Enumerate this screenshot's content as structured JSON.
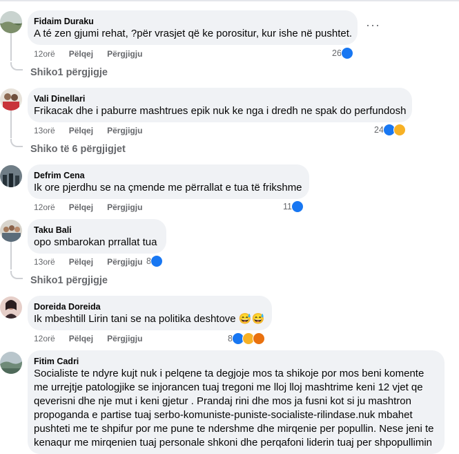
{
  "comments": [
    {
      "author": "Fidaim Duraku",
      "text": "A té zen gjumi rehat, ?për vrasjet që ke porositur, kur ishe në pushtet.",
      "time": "12orë",
      "like_label": "Pëlqej",
      "reply_label": "Përgjigju",
      "reaction_count": "26",
      "reactions": [
        "like"
      ],
      "replies_label": "Shiko1 përgjigje",
      "options_label": "···"
    },
    {
      "author": "Vali Dinellari",
      "text": "Frikacak dhe i paburre mashtrues epik nuk ke nga i dredh ne spak do perfundosh",
      "time": "13orë",
      "like_label": "Pëlqej",
      "reply_label": "Përgjigju",
      "reaction_count": "24",
      "reactions": [
        "like",
        "haha"
      ],
      "replies_label": "Shiko të 6 përgjigjet"
    },
    {
      "author": "Defrim Cena",
      "text": "Ik ore pjerdhu se na çmende me përrallat e tua të frikshme",
      "time": "12orë",
      "like_label": "Pëlqej",
      "reply_label": "Përgjigju",
      "reaction_count": "11",
      "reactions": [
        "like"
      ]
    },
    {
      "author": "Taku Bali",
      "text": "opo smbarokan prrallat tua",
      "time": "13orë",
      "like_label": "Pëlqej",
      "reply_label": "Përgjigju",
      "reaction_count": "8",
      "reactions": [
        "like"
      ],
      "replies_label": "Shiko1 përgjigje"
    },
    {
      "author": "Doreida Doreida",
      "text": "Ik mbeshtill Lirin tani se na politika deshtove 😅😅",
      "time": "12orë",
      "like_label": "Pëlqej",
      "reply_label": "Përgjigju",
      "reaction_count": "8",
      "reactions": [
        "like",
        "haha",
        "angry"
      ]
    },
    {
      "author": "Fitim Cadri",
      "text": "Socialiste te ndyre kujt nuk i pelqene ta degjoje mos ta shikoje por mos beni komente me urrejtje patologjike se injorancen tuaj tregoni me lloj lloj mashtrime keni 12 vjet qe qeverisni dhe nje mut i keni gjetur . Prandaj rini dhe mos ja fusni kot si ju mashtron propoganda e partise tuaj serbo-komuniste-puniste-socialiste-rilindase.nuk mbahet pushteti me te shpifur por me pune te ndershme dhe mirqenie per popullin. Nese jeni te kenaqur me mirqenien tuaj personale shkoni dhe perqafoni liderin tuaj per shpopullimin"
    }
  ],
  "colors": {
    "bubble": "#f0f2f5",
    "meta": "#65676b",
    "like": "#1877f2",
    "haha": "#f7b125",
    "angry": "#e9710f"
  }
}
